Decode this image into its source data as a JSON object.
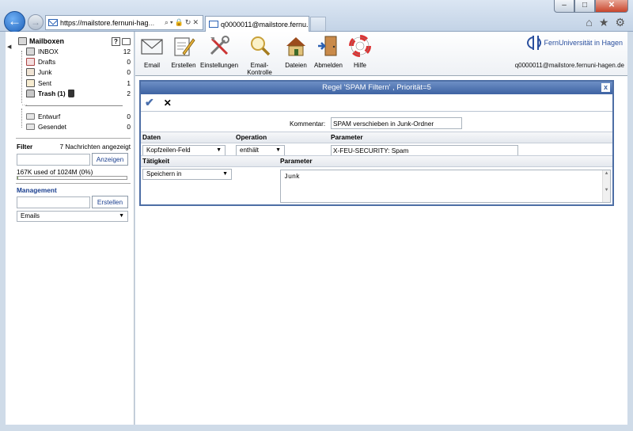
{
  "browser": {
    "url_host": "https://mailstore.fernuni-hag",
    "url_rest": "...",
    "tab_title": "q0000011@mailstore.fernu...",
    "window_buttons": [
      "–",
      "□",
      "✕"
    ]
  },
  "sidebar": {
    "mailbox_title": "Mailboxen",
    "help_label": "?",
    "folders": [
      {
        "name": "INBOX",
        "count": "12",
        "icon": "inbox-icon"
      },
      {
        "name": "Drafts",
        "count": "0",
        "icon": "drafts-icon"
      },
      {
        "name": "Junk",
        "count": "0",
        "icon": "junk-icon"
      },
      {
        "name": "Sent",
        "count": "1",
        "icon": "sent-icon"
      },
      {
        "name": "Trash (1)",
        "count": "2",
        "icon": "trash-icon"
      }
    ],
    "local_folders": [
      {
        "name": "Entwurf",
        "count": "0"
      },
      {
        "name": "Gesendet",
        "count": "0"
      }
    ],
    "filter_label": "Filter",
    "filter_hint": "7 Nachrichten angezeigt",
    "filter_value": "",
    "show_button": "Anzeigen",
    "quota_text": "167K used of 1024M  (0%)",
    "quota_fraction": 0.002,
    "management_label": "Management",
    "management_value": "",
    "create_button": "Erstellen",
    "management_select": "Emails"
  },
  "toolbar": {
    "items": [
      {
        "label": "Email",
        "icon": "envelope-icon"
      },
      {
        "label": "Erstellen",
        "icon": "compose-icon"
      },
      {
        "label": "Einstellungen",
        "icon": "tools-icon"
      },
      {
        "label": "Email-Kontrolle",
        "icon": "magnifier-icon"
      },
      {
        "label": "Dateien",
        "icon": "house-icon"
      },
      {
        "label": "Abmelden",
        "icon": "logout-door-icon"
      },
      {
        "label": "Hilfe",
        "icon": "lifebuoy-icon"
      }
    ],
    "logo_text": "FernUniversität in Hagen",
    "user_email": "q0000011@mailstore.fernuni-hagen.de"
  },
  "dialog": {
    "title": "Regel 'SPAM Filtern' , Priorität=5",
    "close_label": "x",
    "kommentar_label": "Kommentar:",
    "kommentar_value": "SPAM verschieben in Junk-Ordner",
    "daten_header": "Daten",
    "operation_header": "Operation",
    "parameter_header": "Parameter",
    "daten_value": "Kopfzeilen-Feld",
    "operation_value": "enthält",
    "parameter_value": "X-FEU-SECURITY: Spam",
    "taetigkeit_header": "Tätigkeit",
    "parameter2_header": "Parameter",
    "taetigkeit_value": "Speichern in",
    "parameter2_value": "Junk"
  }
}
